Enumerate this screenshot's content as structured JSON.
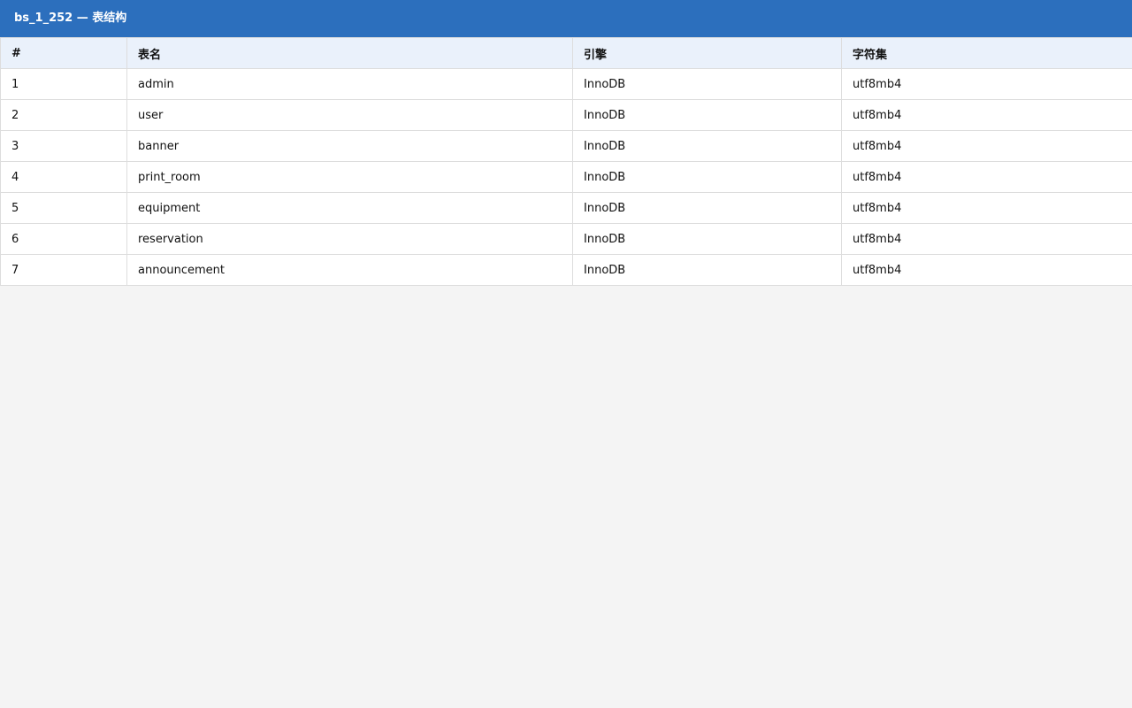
{
  "header": {
    "title": "bs_1_252 — 表结构"
  },
  "table": {
    "columns": [
      "#",
      "表名",
      "引擎",
      "字符集"
    ],
    "rows": [
      [
        "1",
        "admin",
        "InnoDB",
        "utf8mb4"
      ],
      [
        "2",
        "user",
        "InnoDB",
        "utf8mb4"
      ],
      [
        "3",
        "banner",
        "InnoDB",
        "utf8mb4"
      ],
      [
        "4",
        "print_room",
        "InnoDB",
        "utf8mb4"
      ],
      [
        "5",
        "equipment",
        "InnoDB",
        "utf8mb4"
      ],
      [
        "6",
        "reservation",
        "InnoDB",
        "utf8mb4"
      ],
      [
        "7",
        "announcement",
        "InnoDB",
        "utf8mb4"
      ]
    ]
  },
  "colors": {
    "header_bg": "#2c6fbd",
    "table_header_bg": "#eaf1fb",
    "page_bg": "#f4f4f4"
  }
}
